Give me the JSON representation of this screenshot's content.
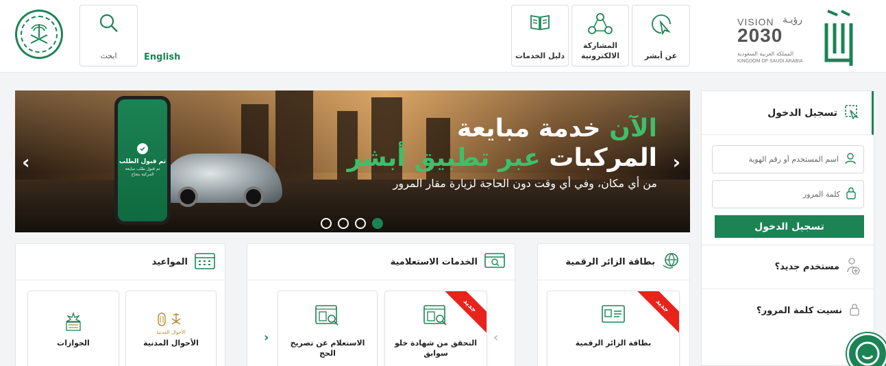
{
  "header": {
    "search_label": "ابحث",
    "language_link": "English",
    "nav": [
      {
        "label": "دليل الخدمات",
        "icon": "book-icon"
      },
      {
        "label": "المشاركة الالكترونية",
        "icon": "network-share-icon"
      },
      {
        "label": "عن أبشر",
        "icon": "cursor-click-icon"
      }
    ],
    "vision": {
      "word": "VISION",
      "arabic_word": "رؤيـة",
      "year": "2030",
      "kingdom_ar": "المملكة العربية السعودية",
      "kingdom_en": "KINGDOM OF SAUDI ARABIA"
    }
  },
  "hero": {
    "line1_highlight": "الآن",
    "line1_rest": "خدمة مبايعة",
    "line2_rest": "المركبات",
    "line2_highlight": "عبر تطبيق أبشر",
    "line3": "من أي مكان، وفي أي وقت دون الحاجة لزيارة مقار المرور",
    "phone_title": "تم قبول الطلب",
    "phone_sub": "تم قبول طلب مبايعة المركبة بنجاح",
    "slides_count": 4,
    "active_slide": 1,
    "prev_arrow": "‹",
    "next_arrow": "›"
  },
  "login": {
    "title": "تسجيل الدخول",
    "username_placeholder": "اسم المستخدم أو رقم الهوية",
    "password_placeholder": "كلمة المرور",
    "submit_label": "تسجيل الدخول",
    "new_user": "مستخدم جديد؟",
    "forgot_password": "نسيت كلمة المرور؟"
  },
  "sections": {
    "visitor": {
      "title": "بطاقة الزائر الرقمية"
    },
    "inquiry": {
      "title": "الخدمات الاستعلامية"
    },
    "appointments": {
      "title": "المواعيد"
    }
  },
  "cards": {
    "visitor_card": {
      "label": "بطاقة الزائر الرقمية",
      "badge": "جديد"
    },
    "clearance": {
      "label": "التحقق من شهادة خلو سوابق",
      "badge": "جديد"
    },
    "hajj": {
      "label": "الاستعلام عن تصريح الحج"
    },
    "civil": {
      "label": "الأحوال المدنية",
      "logo_text": "الأحوال المدنية"
    },
    "passports": {
      "label": "الجوازات"
    },
    "carousel_prev": "‹",
    "carousel_next": "›"
  },
  "colors": {
    "brand_green": "#1b8354",
    "badge_red": "#e8231c",
    "highlight_green": "#3fbf6a"
  }
}
